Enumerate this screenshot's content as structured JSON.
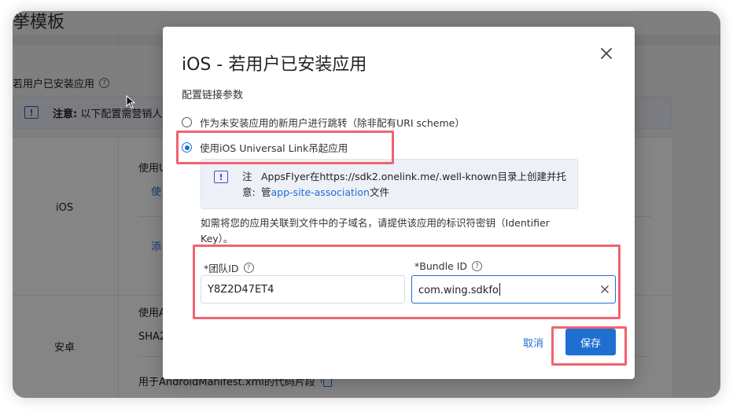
{
  "background": {
    "page_title": "挙模板",
    "section_label": "若用户已安装应用",
    "notice_prefix": "注意:",
    "notice_text": "以下配置需营销人员",
    "rows": {
      "ios": {
        "label": "iOS",
        "text": "使用U",
        "link1": "使",
        "link2": "添"
      },
      "android": {
        "label": "安卓",
        "text1": "使用A",
        "text2": "SHA2",
        "manifest_text": "用于AndroidManifest.xml的代码片段"
      }
    }
  },
  "modal": {
    "title": "iOS - 若用户已安装应用",
    "subhead": "配置链接参数",
    "options": [
      {
        "label": "作为未安装应用的新用户进行跳转（除非配有URI scheme）",
        "checked": false
      },
      {
        "label": "使用iOS Universal Link吊起应用",
        "checked": true
      }
    ],
    "info": {
      "label": "注意:",
      "text_before": "AppsFlyer在https://sdk2.onelink.me/.well-known目录上创建并托管",
      "link": "app-site-association",
      "text_after": "文件"
    },
    "description": "如需将您的应用关联到文件中的子域名，请提供该应用的标识符密钥（Identifier Key）。",
    "team_id": {
      "label": "*团队ID",
      "value": "Y8Z2D47ET4"
    },
    "bundle_id": {
      "label": "*Bundle ID",
      "value": "com.wing.sdkfo"
    },
    "cancel_label": "取消",
    "save_label": "保存"
  },
  "colors": {
    "accent": "#1f6fd1",
    "highlight": "#ef6470",
    "notice_bg": "#eceef8"
  }
}
